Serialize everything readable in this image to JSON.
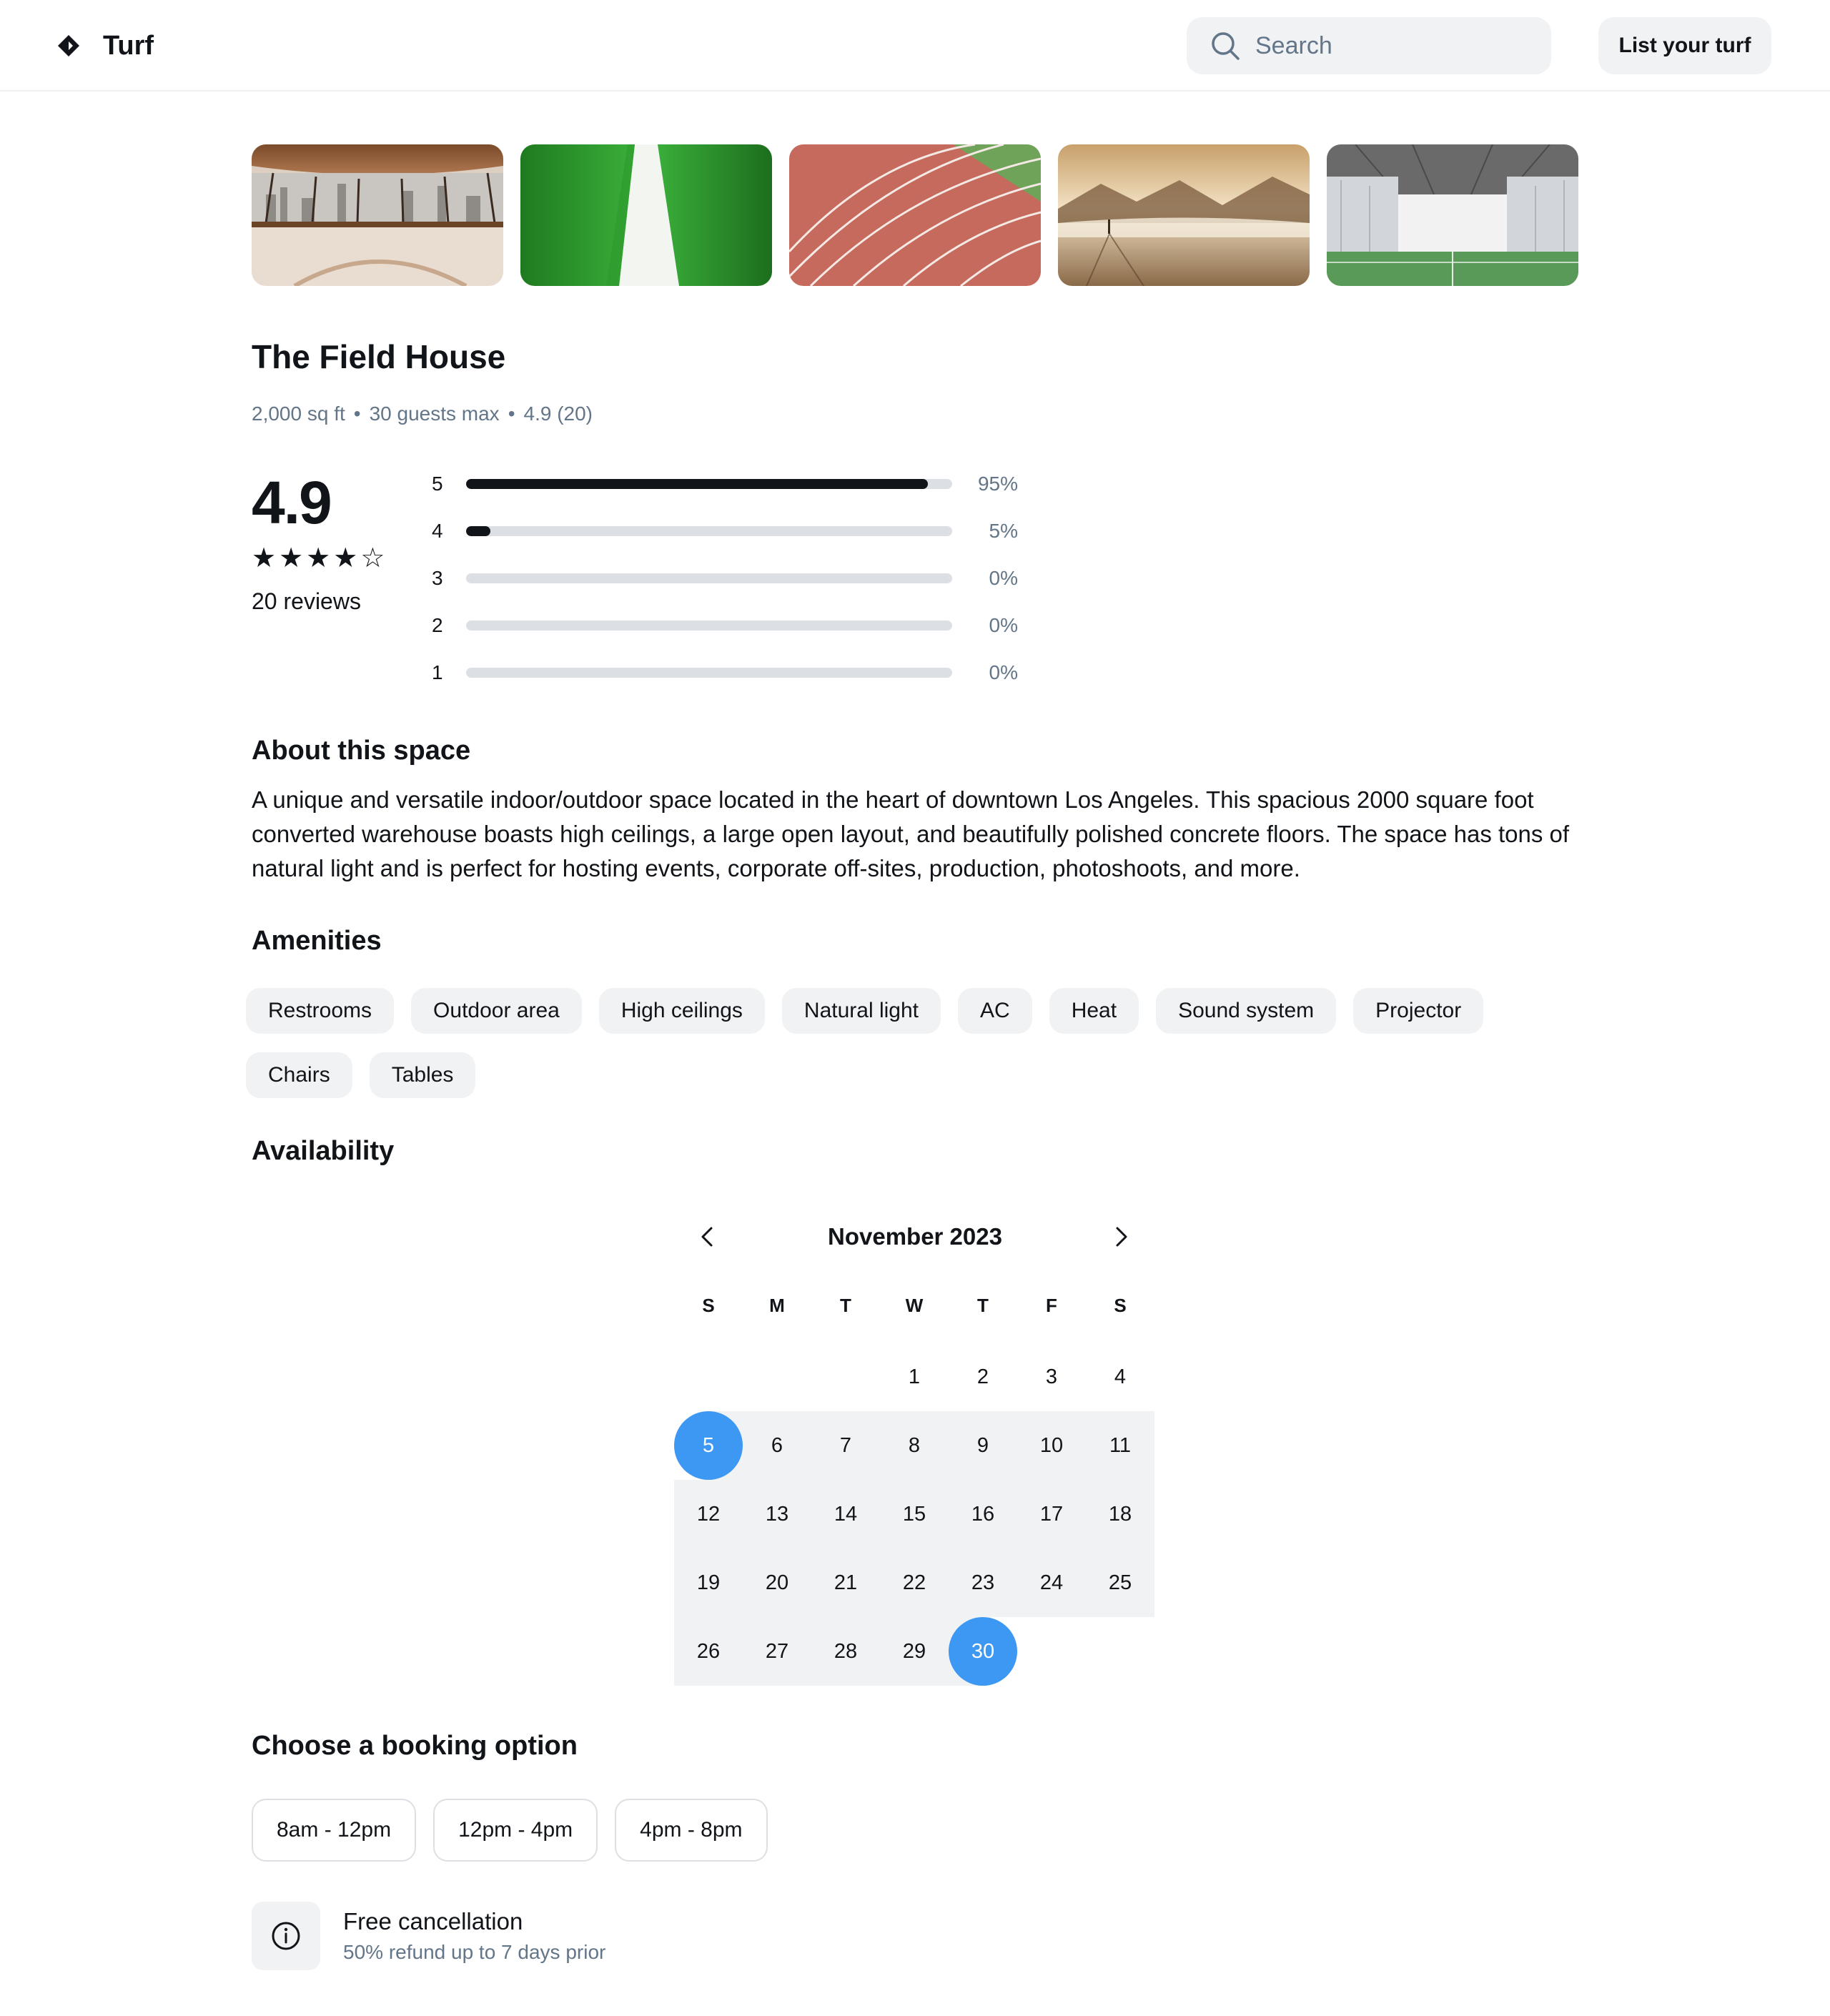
{
  "header": {
    "brand": "Turf",
    "logo_icon": "diamond-logo-icon",
    "search": {
      "placeholder": "Search",
      "value": ""
    },
    "list_button": "List your turf"
  },
  "gallery": [
    {
      "subject": "indoor court with city skyline windows"
    },
    {
      "subject": "green turf with white stripe"
    },
    {
      "subject": "red running track"
    },
    {
      "subject": "misty desert landscape"
    },
    {
      "subject": "indoor warehouse field"
    }
  ],
  "listing": {
    "title": "The Field House",
    "meta": [
      "2,000 sq ft",
      "30 guests max",
      "4.9 (20)"
    ]
  },
  "rating": {
    "value": "4.9",
    "stars_filled": 4,
    "stars_total": 5,
    "reviews_label": "20 reviews",
    "distribution": [
      {
        "label": "5",
        "pct_text": "95%",
        "fraction": 0.95
      },
      {
        "label": "4",
        "pct_text": "5%",
        "fraction": 0.05
      },
      {
        "label": "3",
        "pct_text": "0%",
        "fraction": 0.0
      },
      {
        "label": "2",
        "pct_text": "0%",
        "fraction": 0.0
      },
      {
        "label": "1",
        "pct_text": "0%",
        "fraction": 0.0
      }
    ]
  },
  "about": {
    "heading": "About this space",
    "text": "A unique and versatile indoor/outdoor space located in the heart of downtown Los Angeles. This spacious 2000 square foot converted warehouse boasts high ceilings, a large open layout, and beautifully polished concrete floors. The space has tons of natural light and is perfect for hosting events, corporate off-sites, production, photoshoots, and more."
  },
  "amenities": {
    "heading": "Amenities",
    "items": [
      "Restrooms",
      "Outdoor area",
      "High ceilings",
      "Natural light",
      "AC",
      "Heat",
      "Sound system",
      "Projector",
      "Chairs",
      "Tables"
    ]
  },
  "availability": {
    "heading": "Availability",
    "month_label": "November 2023",
    "weekdays": [
      "S",
      "M",
      "T",
      "W",
      "T",
      "F",
      "S"
    ],
    "first_weekday_index": 3,
    "days_in_month": 30,
    "range_start": 5,
    "range_end": 30
  },
  "booking": {
    "heading": "Choose a booking option",
    "options": [
      "8am - 12pm",
      "12pm - 4pm",
      "4pm - 8pm"
    ]
  },
  "cancellation": {
    "icon": "info-icon",
    "title": "Free cancellation",
    "subtitle": "50% refund up to 7 days prior"
  },
  "colors": {
    "accent": "#3d98f4",
    "text": "#111418",
    "muted": "#637588",
    "chip_bg": "#f0f2f4",
    "track": "#dce0e5"
  }
}
